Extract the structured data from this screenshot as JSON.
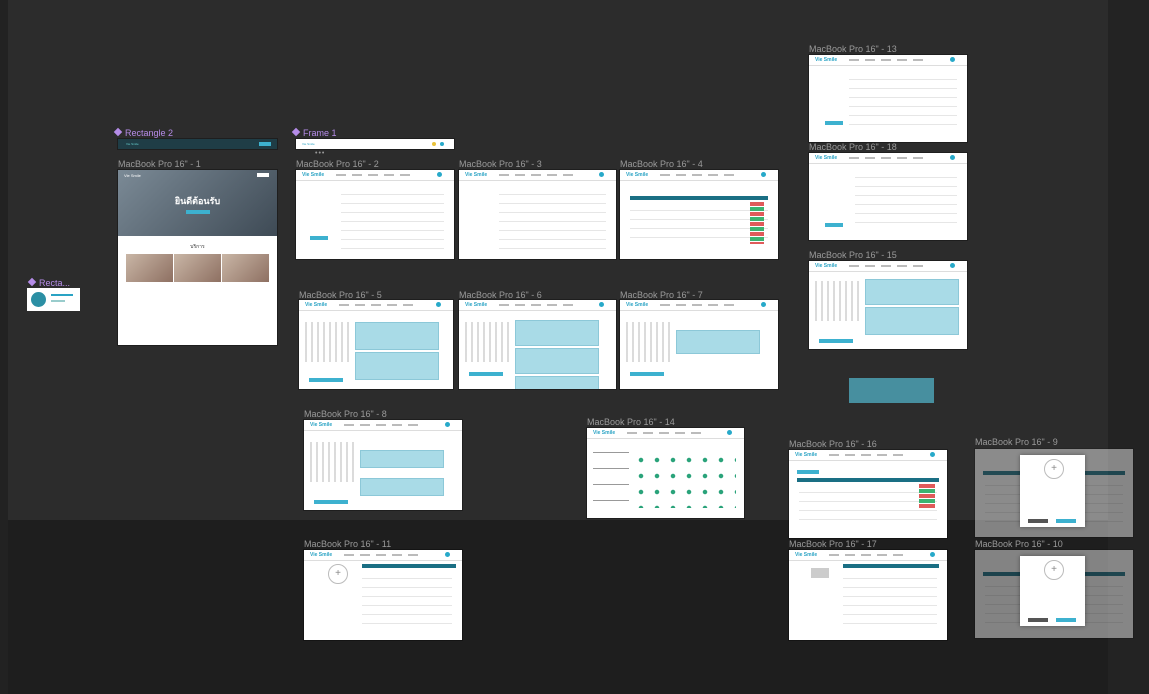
{
  "canvas": {
    "bg_top": "#2c2c2c",
    "bg_bottom": "#1e1e1e"
  },
  "components": [
    {
      "label": "Rectangle 2",
      "icon": "component-icon"
    },
    {
      "label": "Frame 1",
      "icon": "component-icon"
    },
    {
      "label": "Recta...",
      "icon": "component-icon"
    }
  ],
  "frames": {
    "f1": "MacBook Pro 16\" - 1",
    "f2": "MacBook Pro 16\" - 2",
    "f3": "MacBook Pro 16\" - 3",
    "f4": "MacBook Pro 16\" - 4",
    "f5": "MacBook Pro 16\" - 5",
    "f6": "MacBook Pro 16\" - 6",
    "f7": "MacBook Pro 16\" - 7",
    "f8": "MacBook Pro 16\" - 8",
    "f9": "MacBook Pro 16\" - 9",
    "f10": "MacBook Pro 16\" - 10",
    "f11": "MacBook Pro 16\" - 11",
    "f13": "MacBook Pro 16\" - 13",
    "f14": "MacBook Pro 16\" - 14",
    "f15": "MacBook Pro 16\" - 15",
    "f16": "MacBook Pro 16\" - 16",
    "f17": "MacBook Pro 16\" - 17",
    "f18": "MacBook Pro 16\" - 18"
  },
  "home_page": {
    "logo": "Vie Smile",
    "hero_title": "ยินดีต้อนรับ",
    "section_title": "บริการ"
  },
  "app_logo": "Vie Smile",
  "colors": {
    "accent": "#2aa3c4",
    "card": "#a9dbe7",
    "header": "#1a6f84",
    "component": "#b58ce8"
  }
}
